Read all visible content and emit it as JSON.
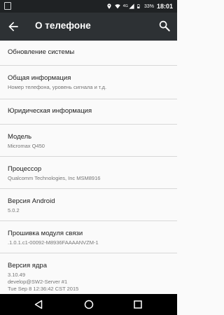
{
  "status_bar": {
    "network": "4G",
    "battery_pct": "33%",
    "time": "18:01"
  },
  "app_bar": {
    "title": "О телефоне"
  },
  "items": [
    {
      "title": "Обновление системы"
    },
    {
      "title": "Общая информация",
      "subtitle": "Номер телефона, уровень сигнала и т.д."
    },
    {
      "title": "Юридическая информация"
    },
    {
      "title": "Модель",
      "subtitle": "Micromax Q450"
    },
    {
      "title": "Процессор",
      "subtitle": "Qualcomm Technologies, Inc MSM8916"
    },
    {
      "title": "Версия Android",
      "subtitle": "5.0.2"
    },
    {
      "title": "Прошивка модуля связи",
      "subtitle": ".1.0.1.c1-00092-M8936FAAAANVZM-1"
    },
    {
      "title": "Версия ядра",
      "subtitle": "3.10.49",
      "subtitle2": "develop@SW2-Server #1",
      "subtitle3": "Tue Sep 8 12:36:42 CST 2015"
    }
  ],
  "icons": {
    "back": "arrow-back-icon",
    "search": "search-icon",
    "nav_back": "triangle-back-icon",
    "nav_home": "circle-home-icon",
    "nav_recents": "square-recents-icon"
  }
}
